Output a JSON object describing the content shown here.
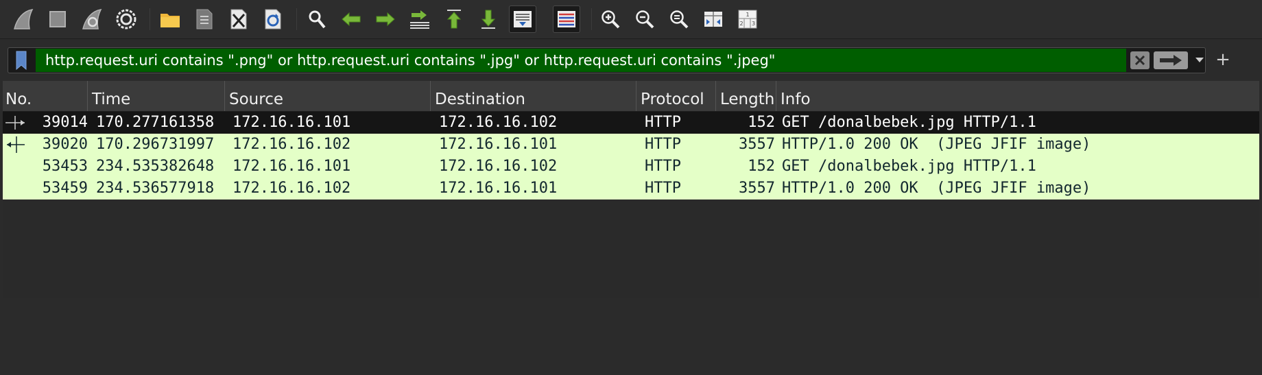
{
  "toolbar": {
    "icons": [
      "shark-fin-start-icon",
      "stop-square-icon",
      "shark-fin-restart-icon",
      "capture-options-gear-icon",
      "open-folder-icon",
      "save-file-icon",
      "close-file-icon",
      "reload-icon",
      "find-packet-icon",
      "go-back-icon",
      "go-forward-icon",
      "go-to-packet-icon",
      "first-packet-icon",
      "last-packet-icon",
      "auto-scroll-icon",
      "colorize-icon",
      "zoom-in-icon",
      "zoom-out-icon",
      "normal-size-icon",
      "resize-columns-icon",
      "layout-grid-icon"
    ]
  },
  "filter": {
    "expression": "http.request.uri contains \".png\" or http.request.uri contains \".jpg\" or http.request.uri contains \".jpeg\"",
    "valid_color": "#005e00",
    "add_label": "+"
  },
  "columns": {
    "no": "No.",
    "time": "Time",
    "source": "Source",
    "destination": "Destination",
    "protocol": "Protocol",
    "length": "Length",
    "info": "Info"
  },
  "packets": [
    {
      "no": "39014",
      "time": "170.277161358",
      "source": "172.16.16.101",
      "destination": "172.16.16.102",
      "protocol": "HTTP",
      "length": "152",
      "info": "GET /donalbebek.jpg HTTP/1.1"
    },
    {
      "no": "39020",
      "time": "170.296731997",
      "source": "172.16.16.102",
      "destination": "172.16.16.101",
      "protocol": "HTTP",
      "length": "3557",
      "info": "HTTP/1.0 200 OK  (JPEG JFIF image)"
    },
    {
      "no": "53453",
      "time": "234.535382648",
      "source": "172.16.16.101",
      "destination": "172.16.16.102",
      "protocol": "HTTP",
      "length": "152",
      "info": "GET /donalbebek.jpg HTTP/1.1"
    },
    {
      "no": "53459",
      "time": "234.536577918",
      "source": "172.16.16.102",
      "destination": "172.16.16.101",
      "protocol": "HTTP",
      "length": "3557",
      "info": "HTTP/1.0 200 OK  (JPEG JFIF image)"
    }
  ],
  "colors": {
    "selected_row": "#151515",
    "http_row": "#e4ffc7",
    "http_text": "#12272e"
  }
}
